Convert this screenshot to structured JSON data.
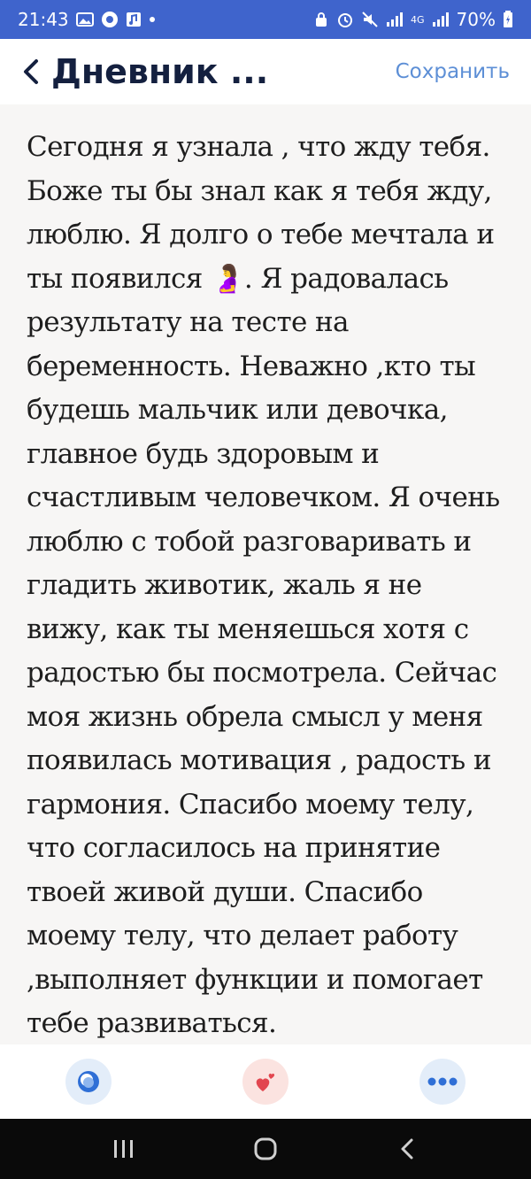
{
  "status_bar": {
    "time": "21:43",
    "battery": "70%",
    "network_label": "4G"
  },
  "header": {
    "title": "Дневник ...",
    "save_label": "Сохранить"
  },
  "entry": {
    "text": "Сегодня я узнала , что жду тебя. Боже ты бы знал как я тебя жду, люблю. Я долго о тебе мечтала и ты появился 🤰. Я радовалась результату на тесте на беременность. Неважно ,кто ты будешь мальчик или девочка, главное будь здоровым и счастливым человечком. Я очень люблю с тобой разговаривать и гладить животик, жаль я не вижу, как ты меняешься хотя с радостью бы посмотрела. Сейчас моя жизнь обрела смысл у меня появилась мотивация , радость и гармония. Спасибо моему телу, что согласилось на принятие твоей живой души. Спасибо моему телу, что делает работу ,выполняет функции и помогает тебе развиваться."
  },
  "toolbar": {
    "items": [
      {
        "icon": "mood-icon",
        "bg": "#e3edf9",
        "color": "#2f6fd6"
      },
      {
        "icon": "hearts-icon",
        "bg": "#fbe3e0",
        "color": "#e2464f"
      },
      {
        "icon": "more-dots-icon",
        "bg": "#e3edf9",
        "color": "#2f6fd6"
      }
    ]
  },
  "colors": {
    "status_bar": "#3f64cc",
    "accent": "#5d8fd6",
    "title": "#14203f"
  }
}
